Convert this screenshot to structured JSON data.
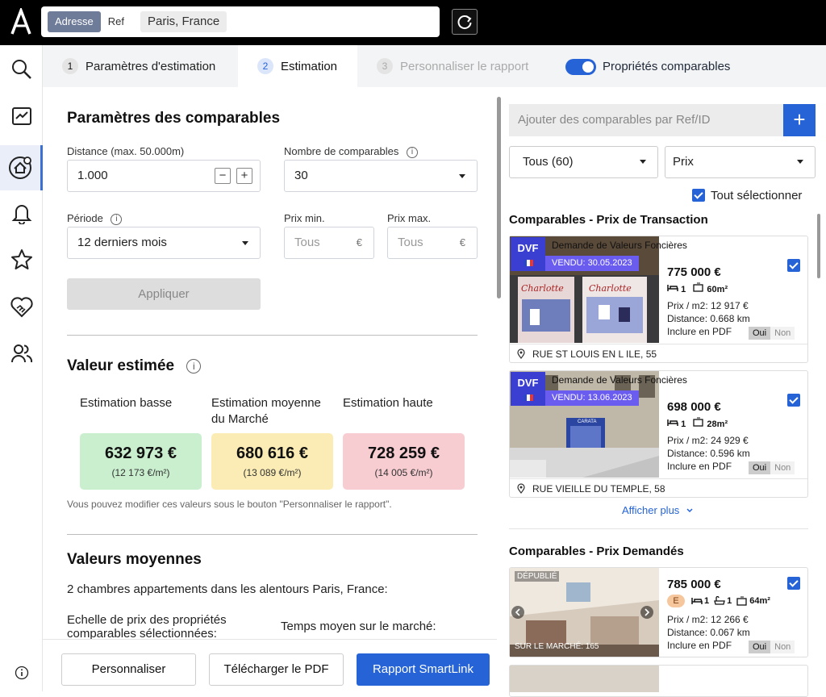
{
  "topbar": {
    "mode_tabs": [
      "Adresse",
      "Ref"
    ],
    "address": "Paris, France"
  },
  "tabs": [
    {
      "num": "1",
      "label": "Paramètres d'estimation"
    },
    {
      "num": "2",
      "label": "Estimation"
    },
    {
      "num": "3",
      "label": "Personnaliser le rapport"
    }
  ],
  "toggle_label": "Propriétés comparables",
  "params": {
    "title": "Paramètres des comparables",
    "distance_label": "Distance (max. 50.000m)",
    "distance_value": "1.000",
    "count_label": "Nombre de comparables",
    "count_value": "30",
    "period_label": "Période",
    "period_value": "12 derniers mois",
    "price_min_label": "Prix min.",
    "price_max_label": "Prix max.",
    "price_placeholder": "Tous",
    "currency": "€",
    "apply": "Appliquer"
  },
  "estimated": {
    "title": "Valeur estimée",
    "low_label": "Estimation basse",
    "mid_label_1": "Estimation moyenne",
    "mid_label_2": "du Marché",
    "high_label": "Estimation haute",
    "low_value": "632 973 €",
    "low_m2": "(12 173 €/m²)",
    "mid_value": "680 616 €",
    "mid_m2": "(13 089 €/m²)",
    "high_value": "728 259 €",
    "high_m2": "(14 005 €/m²)",
    "colors": {
      "low": "#c9efcf",
      "mid": "#faecb4",
      "high": "#f7cdd2"
    },
    "note": "Vous pouvez modifier ces valeurs sous le bouton \"Personnaliser le rapport\"."
  },
  "averages": {
    "title": "Valeurs moyennes",
    "subtitle": "2 chambres appartements dans les alentours Paris, France:",
    "range_label_1": "Echelle de prix des propriétés",
    "range_label_2": "comparables sélectionnées:",
    "time_label": "Temps moyen sur le marché:"
  },
  "buttons": {
    "customize": "Personnaliser",
    "download": "Télécharger le PDF",
    "report": "Rapport SmartLink"
  },
  "right": {
    "add_placeholder": "Ajouter des comparables par Ref/ID",
    "filter": "Tous (60)",
    "sort": "Prix",
    "select_all": "Tout sélectionner",
    "section1": "Comparables - Prix de Transaction",
    "section2": "Comparables - Prix Demandés",
    "show_more": "Afficher plus",
    "cards": [
      {
        "badge": "DVF",
        "source": "Demande de Valeurs Foncières",
        "sold": "VENDU: 30.05.2023",
        "price": "775 000 €",
        "rooms": "1",
        "area": "60m²",
        "ppm": "Prix / m2: 12 917 €",
        "distance": "Distance: 0.668 km",
        "pdf": "Inclure en PDF",
        "yes": "Oui",
        "no": "Non",
        "address": "RUE ST LOUIS EN L ILE, 55",
        "shop_sign": "Charlotte"
      },
      {
        "badge": "DVF",
        "source": "Demande de Valeurs Foncières",
        "sold": "VENDU: 13.06.2023",
        "price": "698 000 €",
        "rooms": "1",
        "area": "28m²",
        "ppm": "Prix / m2: 24 929 €",
        "distance": "Distance: 0.596 km",
        "pdf": "Inclure en PDF",
        "yes": "Oui",
        "no": "Non",
        "address": "RUE VIEILLE DU TEMPLE, 58",
        "shop_sign": "CARATA"
      },
      {
        "published": "DÉPUBLIÉ",
        "market": "SUR LE MARCHÉ: 165",
        "price": "785 000 €",
        "energy": "E",
        "beds": "1",
        "baths": "1",
        "area": "64m²",
        "ppm": "Prix / m2: 12 266 €",
        "distance": "Distance: 0.067 km",
        "pdf": "Inclure en PDF",
        "yes": "Oui",
        "no": "Non"
      }
    ]
  }
}
